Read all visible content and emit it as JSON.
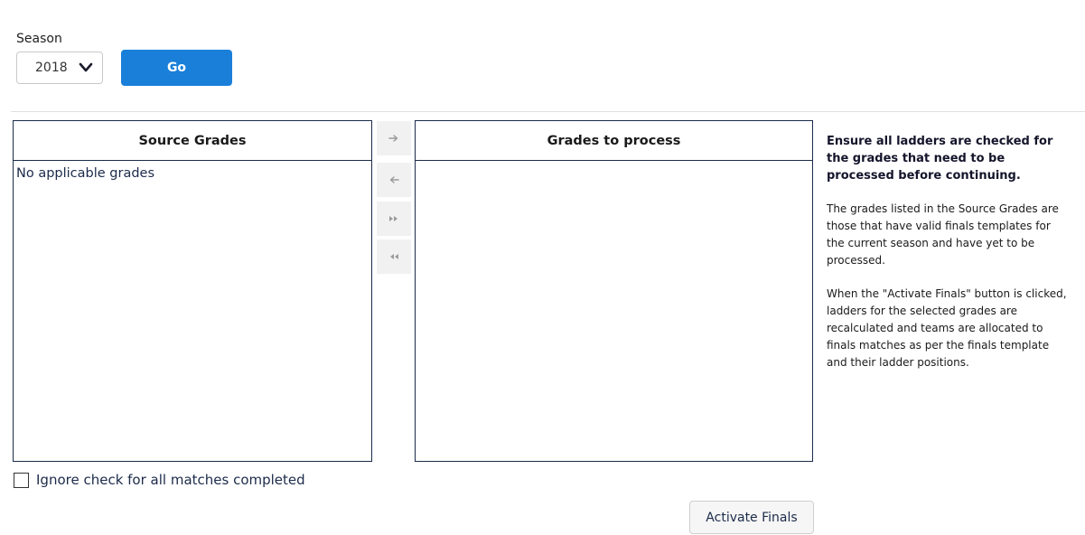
{
  "season": {
    "label": "Season",
    "selected": "2018",
    "go_label": "Go"
  },
  "source_list": {
    "header": "Source Grades",
    "empty_text": "No applicable grades"
  },
  "target_list": {
    "header": "Grades to process"
  },
  "move_buttons": [
    {
      "icon": "arrow-right-icon"
    },
    {
      "icon": "arrow-left-icon"
    },
    {
      "icon": "double-arrow-right-icon"
    },
    {
      "icon": "double-arrow-left-icon"
    }
  ],
  "info": {
    "title": "Ensure all ladders are checked for the grades that need to be processed before continuing.",
    "para1": "The grades listed in the Source Grades are those that have valid finals templates for the current season and have yet to be processed.",
    "para2": "When the \"Activate Finals\" button is clicked, ladders for the selected grades are recalculated and teams are allocated to finals matches as per the finals template and their ladder positions."
  },
  "ignore_check": {
    "label": "Ignore check for all matches completed",
    "checked": false
  },
  "activate_button": {
    "label": "Activate Finals"
  },
  "colors": {
    "primary": "#1a7fd9",
    "list_border": "#1c2b4a",
    "move_button_bg": "#f1f1f1"
  }
}
